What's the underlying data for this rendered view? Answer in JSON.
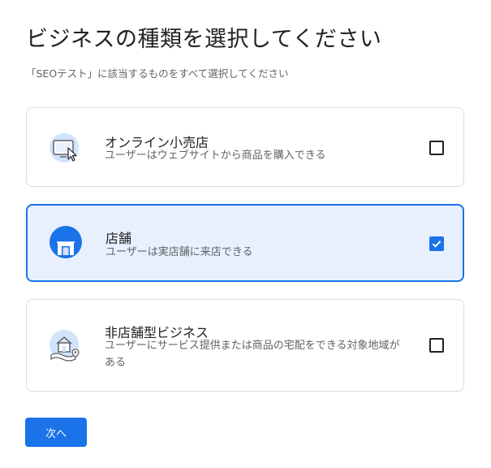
{
  "page": {
    "title": "ビジネスの種類を選択してください",
    "subtitle": "「SEOテスト」に該当するものをすべて選択してください"
  },
  "options": [
    {
      "title": "オンライン小売店",
      "description": "ユーザーはウェブサイトから商品を購入できる",
      "icon": "computer-cursor-icon",
      "checked": false
    },
    {
      "title": "店舗",
      "description": "ユーザーは実店舗に来店できる",
      "icon": "storefront-icon",
      "checked": true
    },
    {
      "title": "非店舗型ビジネス",
      "description": "ユーザーにサービス提供または商品の宅配をできる対象地域がある",
      "icon": "home-map-pin-icon",
      "checked": false
    }
  ],
  "footer": {
    "next_label": "次へ"
  },
  "colors": {
    "accent": "#1a73e8",
    "selected_bg": "#e8f0fe",
    "icon_bg": "#d2e3fc"
  }
}
